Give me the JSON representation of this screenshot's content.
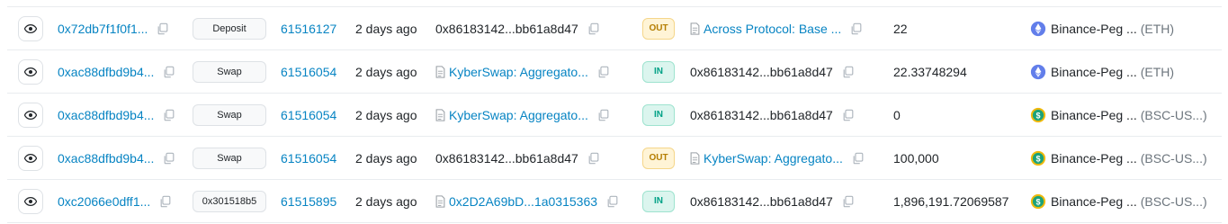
{
  "rows": [
    {
      "txn_hash": "0x72db7f1f0f1...",
      "method": "Deposit",
      "block": "61516127",
      "age": "2 days ago",
      "from": "0x86183142...bb61a8d47",
      "from_is_contract": false,
      "direction": "OUT",
      "to": "Across Protocol: Base ...",
      "to_is_contract": true,
      "amount": "22",
      "token_name": "Binance-Peg ...",
      "token_symbol": "(ETH)",
      "token_icon": "eth-icon"
    },
    {
      "txn_hash": "0xac88dfbd9b4...",
      "method": "Swap",
      "block": "61516054",
      "age": "2 days ago",
      "from": "KyberSwap: Aggregato...",
      "from_is_contract": true,
      "direction": "IN",
      "to": "0x86183142...bb61a8d47",
      "to_is_contract": false,
      "amount": "22.33748294",
      "token_name": "Binance-Peg ...",
      "token_symbol": "(ETH)",
      "token_icon": "eth-icon"
    },
    {
      "txn_hash": "0xac88dfbd9b4...",
      "method": "Swap",
      "block": "61516054",
      "age": "2 days ago",
      "from": "KyberSwap: Aggregato...",
      "from_is_contract": true,
      "direction": "IN",
      "to": "0x86183142...bb61a8d47",
      "to_is_contract": false,
      "amount": "0",
      "token_name": "Binance-Peg ...",
      "token_symbol": "(BSC-US...)",
      "token_icon": "usd-coin-icon"
    },
    {
      "txn_hash": "0xac88dfbd9b4...",
      "method": "Swap",
      "block": "61516054",
      "age": "2 days ago",
      "from": "0x86183142...bb61a8d47",
      "from_is_contract": false,
      "direction": "OUT",
      "to": "KyberSwap: Aggregato...",
      "to_is_contract": true,
      "amount": "100,000",
      "token_name": "Binance-Peg ...",
      "token_symbol": "(BSC-US...)",
      "token_icon": "usd-coin-icon"
    },
    {
      "txn_hash": "0xc2066e0dff1...",
      "method": "0x301518b5",
      "block": "61515895",
      "age": "2 days ago",
      "from": "0x2D2A69bD...1a0315363",
      "from_is_contract": true,
      "direction": "IN",
      "to": "0x86183142...bb61a8d47",
      "to_is_contract": false,
      "amount": "1,896,191.72069587",
      "token_name": "Binance-Peg ...",
      "token_symbol": "(BSC-US...)",
      "token_icon": "usd-coin-icon"
    }
  ],
  "colors": {
    "link": "#0784c3",
    "out_badge_bg": "#fff4d6",
    "in_badge_bg": "#dbf5ee",
    "eth_icon": "#627eea",
    "usd_icon": "#f0b90b"
  }
}
